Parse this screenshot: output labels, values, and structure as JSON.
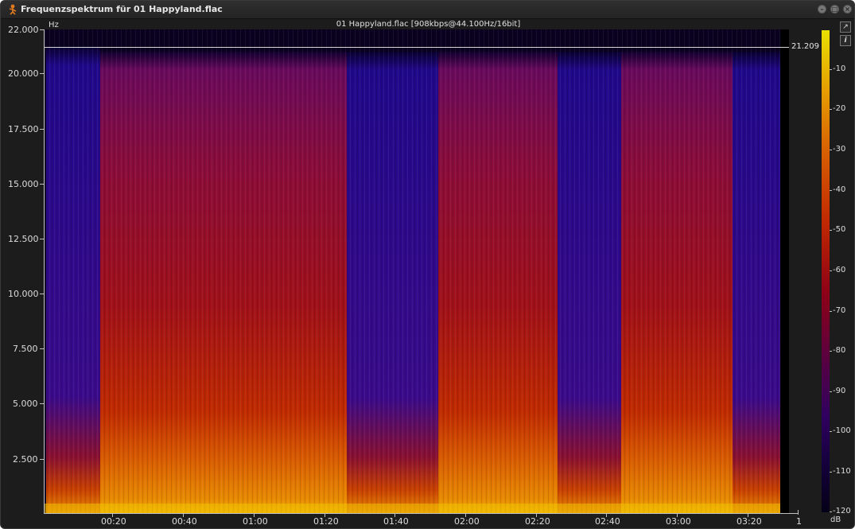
{
  "window": {
    "title": "Frequenzspektrum für 01 Happyland.flac",
    "buttons": [
      "minimize",
      "maximize",
      "close"
    ]
  },
  "spectrogram": {
    "file_title": "01 Happyland.flac [908kbps@44.100Hz/16bit]",
    "y_unit": "Hz",
    "cutoff_label": "21.209",
    "x_end_label": "1",
    "y_ticks": [
      "22.000",
      "20.000",
      "17.500",
      "15.000",
      "12.500",
      "10.000",
      "7.500",
      "5.000",
      "2.500"
    ],
    "x_ticks": [
      "00:20",
      "00:40",
      "01:00",
      "01:20",
      "01:40",
      "02:00",
      "02:20",
      "02:40",
      "03:00",
      "03:20"
    ]
  },
  "colorbar": {
    "unit": "dB",
    "ticks": [
      "-10",
      "-20",
      "-30",
      "-40",
      "-50",
      "-60",
      "-70",
      "-80",
      "-90",
      "-100",
      "-110",
      "-120"
    ],
    "colors": [
      "#e8e000",
      "#e6a000",
      "#d86000",
      "#c02800",
      "#8c0018",
      "#5a0040",
      "#300060",
      "#14003c",
      "#050018"
    ]
  },
  "side_icons": [
    "export-icon",
    "info-icon"
  ]
}
